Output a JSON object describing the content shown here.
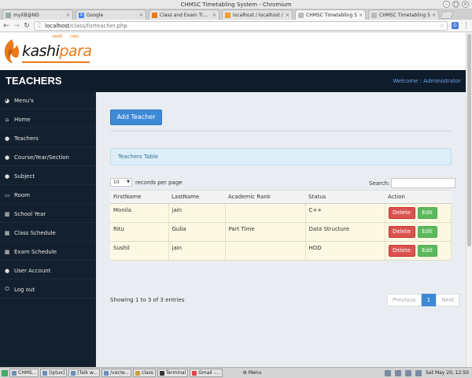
{
  "window": {
    "title": "CHMSC Timetabling System - Chromium"
  },
  "tabs": [
    {
      "label": "myXB@ND",
      "active": false
    },
    {
      "label": "Google",
      "active": false
    },
    {
      "label": "Class and Exam Timeta",
      "active": false
    },
    {
      "label": "localhost / localhost /",
      "active": false
    },
    {
      "label": "CHMSC Timetabling S",
      "active": true
    },
    {
      "label": "CHMSC Timetabling S",
      "active": false
    }
  ],
  "addressbar": {
    "host": "localhost",
    "path": "/class/forteacher.php"
  },
  "brand": {
    "name_a": "kashi",
    "name_b": "para",
    "deco_left": "(काशी)",
    "deco_right": "(पारा)"
  },
  "header": {
    "title": "TEACHERS",
    "welcome": "Welcome : Administrator"
  },
  "sidebar": {
    "items": [
      {
        "label": "Menu's",
        "icon": "dashboard-icon",
        "glyph": "◕"
      },
      {
        "label": "Home",
        "icon": "home-icon",
        "glyph": "⌂"
      },
      {
        "label": "Teachers",
        "icon": "user-icon",
        "glyph": "●"
      },
      {
        "label": "Course/Year/Section",
        "icon": "users-icon",
        "glyph": "●"
      },
      {
        "label": "Subject",
        "icon": "users-icon",
        "glyph": "●"
      },
      {
        "label": "Room",
        "icon": "room-icon",
        "glyph": "▭"
      },
      {
        "label": "School Year",
        "icon": "calendar-icon",
        "glyph": "▦"
      },
      {
        "label": "Class Schedule",
        "icon": "calendar-icon",
        "glyph": "▦"
      },
      {
        "label": "Exam Schedule",
        "icon": "calendar-icon",
        "glyph": "▦"
      },
      {
        "label": "User Account",
        "icon": "users-icon",
        "glyph": "●"
      },
      {
        "label": "Log out",
        "icon": "power-icon",
        "glyph": "⏻"
      }
    ]
  },
  "main": {
    "add_button": "Add Teacher",
    "panel_title": "Teachers Table",
    "length": {
      "value": "10",
      "label": "records per page"
    },
    "search_label": "Search:",
    "search_value": "",
    "columns": [
      "FirstName",
      "LastName",
      "Academic Rank",
      "Status",
      "Action"
    ],
    "rows": [
      {
        "first": "Monila",
        "last": "jain",
        "rank": "",
        "status": "C++"
      },
      {
        "first": "Ritu",
        "last": "Gulia",
        "rank": "Part Time",
        "status": "Data Structure"
      },
      {
        "first": "Sushil",
        "last": "jain",
        "rank": "",
        "status": "HOD"
      }
    ],
    "delete_label": "Delete",
    "edit_label": "Edit",
    "info": "Showing 1 to 3 of 3 entries",
    "pager": {
      "prev": "Previous",
      "current": "1",
      "next": "Next"
    }
  },
  "taskbar": {
    "items": [
      "CHMS...",
      "[iptux]",
      "[Talk w...",
      "/var/w...",
      "class",
      "Terminal",
      "Gmail -..."
    ],
    "menu": "Menu",
    "clock": "Sat May 20, 12:50"
  },
  "colors": {
    "sidebar": "#13202f",
    "header": "#0e1c2c",
    "primary": "#3e89d6",
    "danger": "#d9534f",
    "success": "#5cb85c",
    "brand_orange": "#e87a1c"
  }
}
